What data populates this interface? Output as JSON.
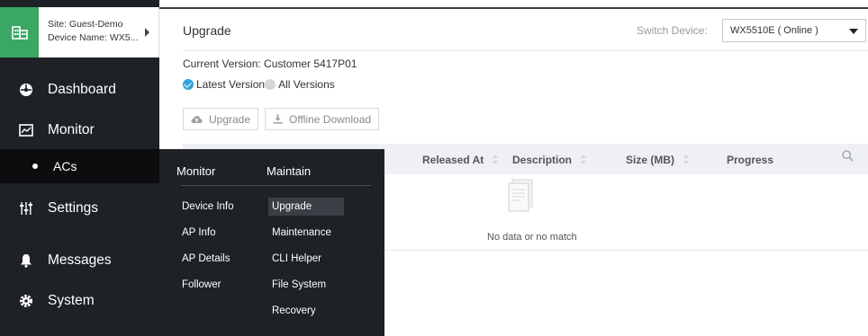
{
  "site": {
    "site_line": "Site: Guest-Demo",
    "device_line": "Device Name: WX5...",
    "icon": "building-icon",
    "accent_color": "#3aa864"
  },
  "sidebar": {
    "items": [
      {
        "label": "Dashboard",
        "icon": "dashboard-icon"
      },
      {
        "label": "Monitor",
        "icon": "monitor-icon"
      },
      {
        "label": "ACs",
        "icon": "bullet-dot"
      },
      {
        "label": "Settings",
        "icon": "sliders-icon"
      },
      {
        "label": "Messages",
        "icon": "bell-icon"
      },
      {
        "label": "System",
        "icon": "gear-icon"
      }
    ]
  },
  "header": {
    "title": "Upgrade",
    "switch_label": "Switch Device:",
    "device_value": "WX5510E ( Online )"
  },
  "content": {
    "current_version": "Current Version: Customer 5417P01",
    "radio_latest": "Latest Version",
    "radio_all": "All Versions",
    "btn_upgrade": "Upgrade",
    "btn_offline": "Offline Download",
    "radio_selected_color": "#2fa4d8"
  },
  "table": {
    "columns": [
      "Released At",
      "Description",
      "Size (MB)",
      "Progress"
    ],
    "empty_text": "No data or no match"
  },
  "flyout": {
    "monitor_header": "Monitor",
    "maintain_header": "Maintain",
    "monitor_items": [
      "Device Info",
      "AP Info",
      "AP Details",
      "Follower"
    ],
    "maintain_items": [
      "Upgrade",
      "Maintenance",
      "CLI Helper",
      "File System",
      "Recovery"
    ]
  }
}
